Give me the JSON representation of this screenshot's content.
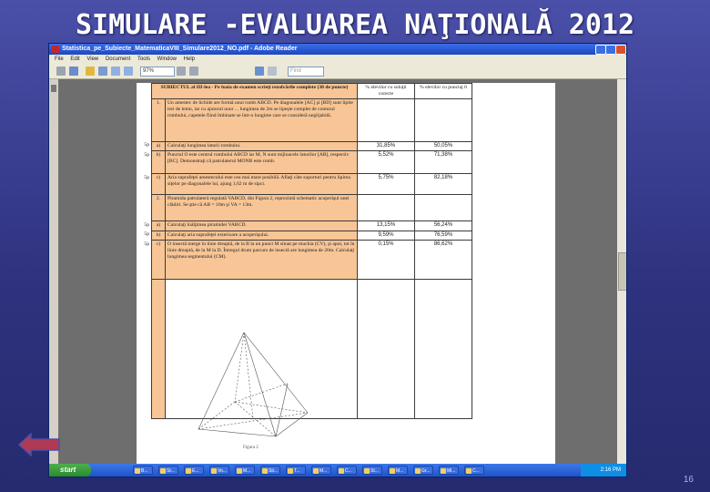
{
  "slide": {
    "title": "SIMULARE -EVALUAREA NAŢIONALĂ 2012",
    "number": "16"
  },
  "window": {
    "title": "Statistica_pe_Subiecte_MatematicaVIII_Simulare2012_NO.pdf - Adobe Reader",
    "menu": [
      "File",
      "Edit",
      "View",
      "Document",
      "Tools",
      "Window",
      "Help"
    ],
    "zoom": "97%",
    "find_placeholder": "Find"
  },
  "sheet": {
    "header": {
      "section": "SUBIECTUL al III-lea - Pe foaia de examen scrieţi rezolvările complete (30 de puncte)",
      "col_correct": "% elevilor cu soluţii corecte",
      "col_zero": "% elevilor cu punctaj 0"
    },
    "problem1": {
      "num": "1.",
      "text": "Un amestec de lichide are formă unui romb ABCD. Pe diagonalele [AC] şi [BD] sunt lipite trei de lemn, iar cu ajutorul unor ... lungimea de 2m se lipeşte complet de conturul rombului, capetele fiind îmbinate se într-o lungime care se consideră neglijabilă."
    },
    "problem2": {
      "num": "2.",
      "text": "Piramida patrulateră regulată VABCD, din Figura 2, reprezintă schematic acoperişul unei clădiri. Se ştie că AB = 10m şi VA = 13m."
    },
    "rows": [
      {
        "score": "5p",
        "part": "a)",
        "text": "Calculaţi lungimea laturii rombului.",
        "correct": "31,85%",
        "zero": "50,05%"
      },
      {
        "score": "5p",
        "part": "b)",
        "text": "Punctul O este centrul rombului ABCD iar M, N sunt mijloacele laturilor [AB], respectiv [BC]. Demonstraţi că patrulaterul MONB este romb.",
        "correct": "5,52%",
        "zero": "71,38%"
      },
      {
        "score": "5p",
        "part": "c)",
        "text": "Aria suprafeţei amestecului este cea mai mare posibilă. Aflaţi câte suporturi pentru lipirea siţelor pe diagonalele lui, ajung 1,62 m de sipci.",
        "correct": "5,75%",
        "zero": "82,18%"
      },
      {
        "score": "5p",
        "part": "a)",
        "text": "Calculaţi înălţimea piramidei VABCD.",
        "correct": "13,15%",
        "zero": "56,24%"
      },
      {
        "score": "5p",
        "part": "b)",
        "text": "Calculaţi aria suprafeţei exterioare a acoperişului.",
        "correct": "9,59%",
        "zero": "76,59%"
      },
      {
        "score": "5p",
        "part": "c)",
        "text": "O insectă merge în linie dreaptă, de la B la un punct M situat pe muchia (CV), şi apoi, tot în linie dreaptă, de la M la D. Întregul drum parcurs de insectă are lungimea de 20m. Calculaţi lungimea segmentului (CM).",
        "correct": "0,15%",
        "zero": "86,62%"
      }
    ],
    "figure_caption": "Figura 2"
  },
  "taskbar": {
    "start": "start",
    "tasks": [
      "B...",
      "St...",
      "E...",
      "Vo...",
      "M...",
      "Sti...",
      "T...",
      "M...",
      "C...",
      "St...",
      "M...",
      "Gr...",
      "Mi...",
      "C..."
    ],
    "clock": "2:16 PM"
  },
  "colors": {
    "slide_bg": "#2f3380",
    "sheet_highlight": "#f7c596",
    "back_button": "#b03a55"
  }
}
